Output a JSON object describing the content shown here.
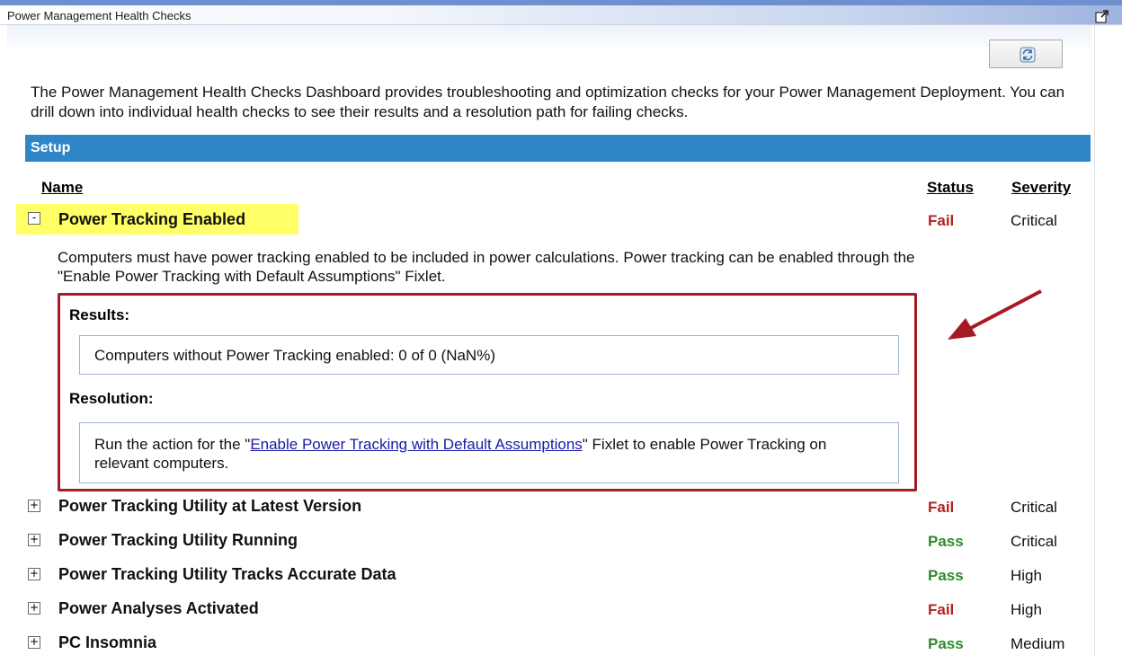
{
  "window": {
    "title": "Power Management Health Checks"
  },
  "intro_text": "The Power Management Health Checks Dashboard provides troubleshooting and optimization checks for your Power Management Deployment. You can drill down into individual health checks to see their results and a resolution path for failing checks.",
  "section": {
    "title": "Setup"
  },
  "columns": {
    "name": "Name",
    "status": "Status",
    "severity": "Severity"
  },
  "expanded": {
    "name": "Power Tracking Enabled",
    "status": "Fail",
    "severity": "Critical",
    "toggle": "-",
    "description": "Computers must have power tracking enabled to be included in power calculations. Power tracking can be enabled through the \"Enable Power Tracking with Default Assumptions\" Fixlet.",
    "results_label": "Results:",
    "results_text": "Computers without Power Tracking enabled: 0 of 0 (NaN%)",
    "resolution_label": "Resolution:",
    "resolution_prefix": "Run the action for the \"",
    "resolution_link": "Enable Power Tracking with Default Assumptions",
    "resolution_suffix": "\" Fixlet to enable Power Tracking on relevant computers."
  },
  "items": [
    {
      "name": "Power Tracking Utility at Latest Version",
      "status": "Fail",
      "severity": "Critical",
      "toggle": "+"
    },
    {
      "name": "Power Tracking Utility Running",
      "status": "Pass",
      "severity": "Critical",
      "toggle": "+"
    },
    {
      "name": "Power Tracking Utility Tracks Accurate Data",
      "status": "Pass",
      "severity": "High",
      "toggle": "+"
    },
    {
      "name": "Power Analyses Activated",
      "status": "Fail",
      "severity": "High",
      "toggle": "+"
    },
    {
      "name": "PC Insomnia",
      "status": "Pass",
      "severity": "Medium",
      "toggle": "+"
    }
  ],
  "colors": {
    "fail": "#b22222",
    "pass": "#2e8b2e",
    "section_bar": "#2e86c8",
    "annotation": "#a61b23",
    "highlight": "#ffff66"
  },
  "icons": {
    "refresh": "refresh-icon",
    "popout": "popout-icon",
    "annotation_arrow": "arrow-icon"
  }
}
